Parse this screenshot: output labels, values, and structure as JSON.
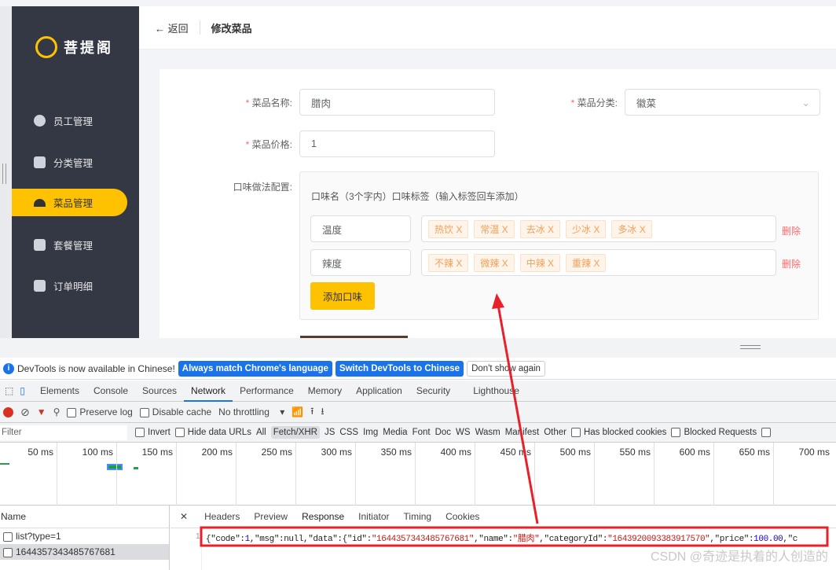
{
  "app": {
    "logo_text": "菩提阁",
    "colors": {
      "accent": "#ffc200",
      "sidebar": "#343744",
      "danger": "#f56c6c",
      "annotation": "#e8202a"
    }
  },
  "sidebar": {
    "items": [
      {
        "label": "员工管理",
        "icon": "user-icon"
      },
      {
        "label": "分类管理",
        "icon": "grid-icon"
      },
      {
        "label": "菜品管理",
        "icon": "cloche-icon",
        "active": true
      },
      {
        "label": "套餐管理",
        "icon": "gift-icon"
      },
      {
        "label": "订单明细",
        "icon": "clipboard-icon"
      }
    ]
  },
  "header": {
    "back_label": "返回",
    "title": "修改菜品"
  },
  "form": {
    "name_label": "菜品名称:",
    "name_value": "腊肉",
    "category_label": "菜品分类:",
    "category_value": "徽菜",
    "price_label": "菜品价格:",
    "price_value": "1",
    "flavor_label": "口味做法配置:",
    "flavor_hint": "口味名（3个字内）口味标签（输入标签回车添加）",
    "flavors": [
      {
        "name": "温度",
        "tags": [
          "热饮 X",
          "常温 X",
          "去冰 X",
          "少冰 X",
          "多冰 X"
        ],
        "delete": "删除"
      },
      {
        "name": "辣度",
        "tags": [
          "不辣 X",
          "微辣 X",
          "中辣 X",
          "重辣 X"
        ],
        "delete": "删除"
      }
    ],
    "add_flavor": "添加口味"
  },
  "devtools": {
    "info": {
      "text": "DevTools is now available in Chinese!",
      "btn1": "Always match Chrome's language",
      "btn2": "Switch DevTools to Chinese",
      "btn3": "Don't show again"
    },
    "tabs": [
      "Elements",
      "Console",
      "Sources",
      "Network",
      "Performance",
      "Memory",
      "Application",
      "Security",
      "Lighthouse"
    ],
    "active_tab": "Network",
    "toolbar": {
      "preserve_log": "Preserve log",
      "disable_cache": "Disable cache",
      "throttling": "No throttling"
    },
    "filter": {
      "placeholder": "Filter",
      "invert": "Invert",
      "hide_data": "Hide data URLs",
      "types": [
        "All",
        "Fetch/XHR",
        "JS",
        "CSS",
        "Img",
        "Media",
        "Font",
        "Doc",
        "WS",
        "Wasm",
        "Manifest",
        "Other"
      ],
      "active_type": "Fetch/XHR",
      "blocked_cookies": "Has blocked cookies",
      "blocked_requests": "Blocked Requests"
    },
    "timeline_ticks": [
      "50 ms",
      "100 ms",
      "150 ms",
      "200 ms",
      "250 ms",
      "300 ms",
      "350 ms",
      "400 ms",
      "450 ms",
      "500 ms",
      "550 ms",
      "600 ms",
      "650 ms",
      "700 ms"
    ],
    "requests": {
      "header": "Name",
      "rows": [
        "list?type=1",
        "1644357343485767681"
      ],
      "selected": 1
    },
    "detail_tabs": [
      "Headers",
      "Preview",
      "Response",
      "Initiator",
      "Timing",
      "Cookies"
    ],
    "active_detail_tab": "Response",
    "response": {
      "line_no": "1",
      "parts": [
        "{\"code\":",
        "1",
        ",\"msg\":null,\"data\":{\"id\":",
        "\"1644357343485767681\"",
        ",\"name\":",
        "\"腊肉\"",
        ",\"categoryId\":",
        "\"1643920093383917570\"",
        ",\"price\":",
        "100.00",
        ",\"c"
      ]
    }
  },
  "watermark": "CSDN @奇迹是执着的人创造的"
}
